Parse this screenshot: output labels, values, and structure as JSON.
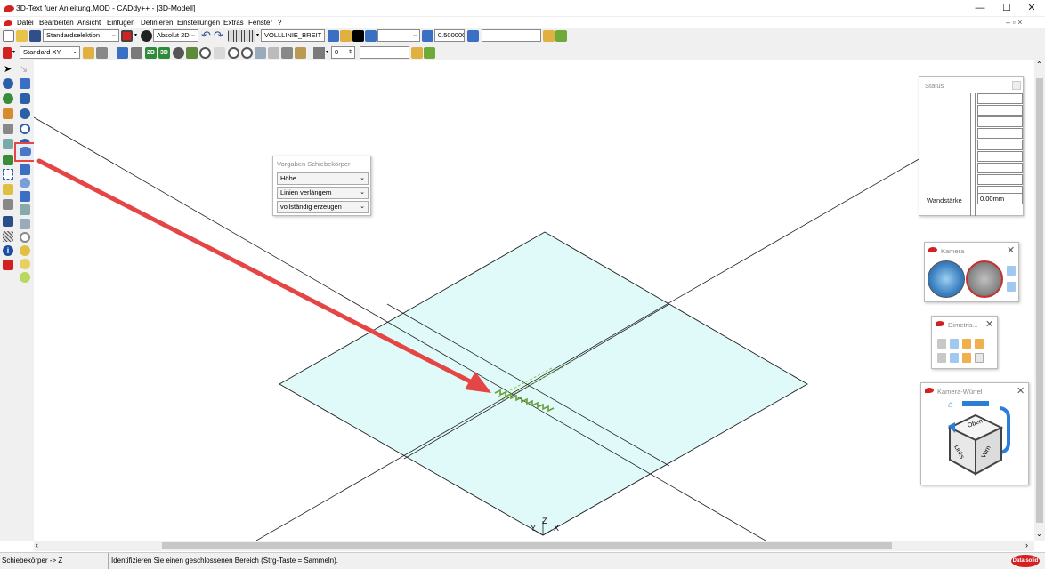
{
  "window": {
    "title": "3D-Text fuer Anleitung.MOD  -  CADdy++ - [3D-Modell]",
    "minimize": "—",
    "maximize": "☐",
    "close": "✕",
    "child_controls": "–  ▫  ×"
  },
  "menu": [
    "Datei",
    "Bearbeiten",
    "Ansicht",
    "Einfügen",
    "Definieren",
    "Einstellungen",
    "Extras",
    "Fenster",
    "?"
  ],
  "toolbar1": {
    "selection_mode": "Standardselektion",
    "coord_mode": "Absolut 2D",
    "line_type": "VOLLLINIE_BREIT",
    "line_width": "0.500000",
    "text_field": ""
  },
  "toolbar2": {
    "view_plane": "Standard XY",
    "btn_2d": "2D",
    "btn_3d": "3D",
    "layer_value": "0",
    "text_field": ""
  },
  "dialog_extrude": {
    "title": "Vorgaben Schiebekörper",
    "options": [
      "Höhe",
      "Linien verlängern",
      "vollständig erzeugen"
    ]
  },
  "panel_status": {
    "title": "Status",
    "wandstaerke_label": "Wandstärke",
    "wandstaerke_value": "0.00mm"
  },
  "panel_kamera": {
    "title": "Kamera"
  },
  "panel_dimetrie": {
    "title": "Dimetris..."
  },
  "panel_cube": {
    "title": "Kamera-Würfel",
    "face_top": "Oben",
    "face_left": "Links",
    "face_front": "Vorn"
  },
  "axes": {
    "y": "Y",
    "z": "Z",
    "x": "X"
  },
  "statusbar": {
    "mode": "Schiebekörper -> Z",
    "message": "Identifizieren Sie einen geschlossenen Bereich (Strg-Taste = Sammeln).",
    "brand": "Data solid"
  },
  "colors": {
    "accent_red": "#d32020",
    "highlight": "#e54545",
    "plane_fill": "#dffaf9",
    "text_green": "#6a9e3a"
  }
}
